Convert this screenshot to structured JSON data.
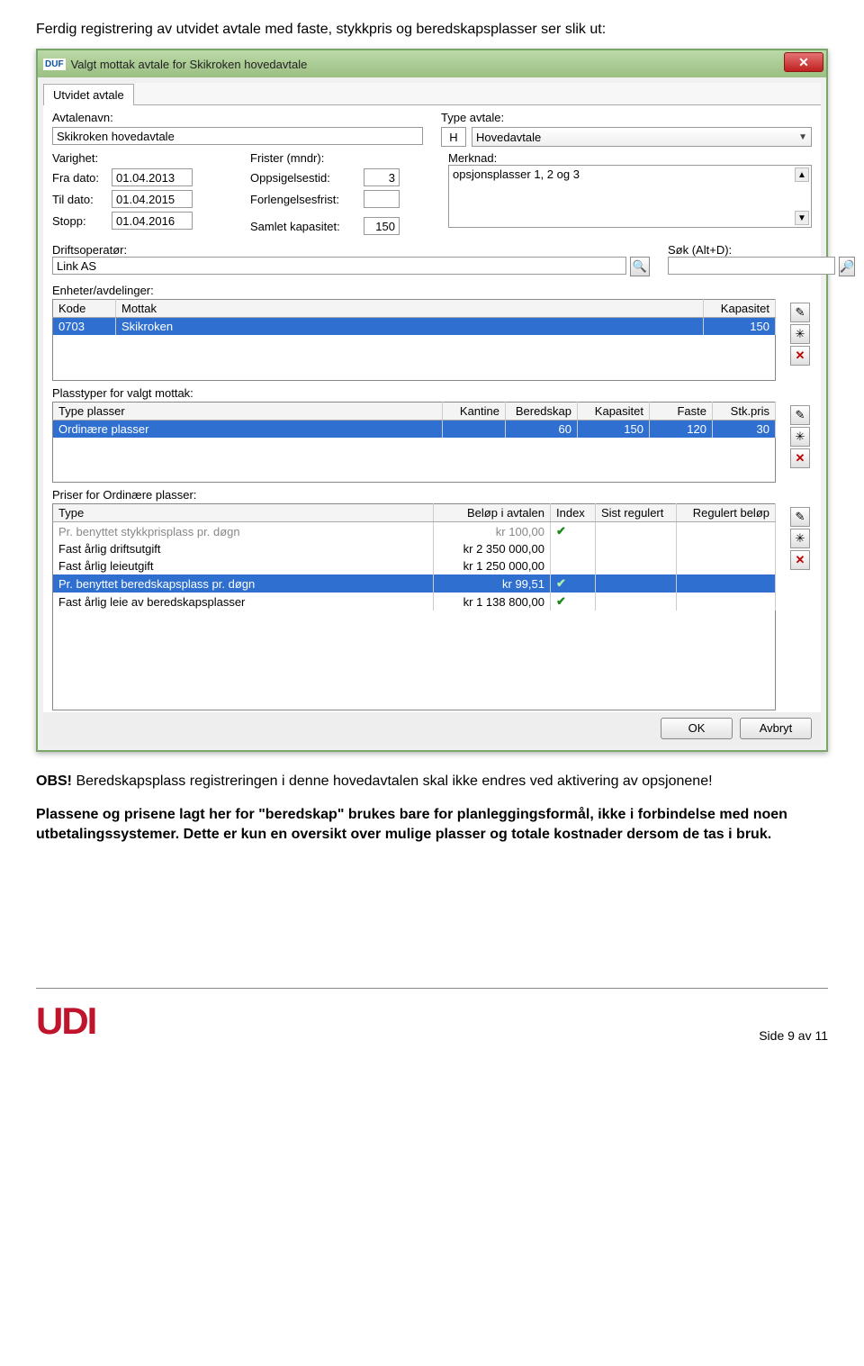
{
  "intro_text": "Ferdig registrering av utvidet avtale med faste, stykkpris og beredskapsplasser ser slik ut:",
  "window": {
    "app_icon_text": "DUF",
    "title": "Valgt mottak avtale for Skikroken hovedavtale",
    "close_symbol": "✕"
  },
  "tab_label": "Utvidet avtale",
  "labels": {
    "avtalenavn": "Avtalenavn:",
    "type_avtale": "Type avtale:",
    "varighet": "Varighet:",
    "fra_dato": "Fra dato:",
    "til_dato": "Til dato:",
    "stopp": "Stopp:",
    "frister": "Frister (mndr):",
    "oppsigelsestid": "Oppsigelsestid:",
    "forlengelsesfrist": "Forlengelsesfrist:",
    "samlet_kapasitet": "Samlet kapasitet:",
    "merknad": "Merknad:",
    "driftsoperator": "Driftsoperatør:",
    "sok": "Søk (Alt+D):",
    "enheter": "Enheter/avdelinger:",
    "plasstyper": "Plasstyper for valgt mottak:",
    "priser": "Priser for Ordinære plasser:"
  },
  "values": {
    "avtalenavn": "Skikroken hovedavtale",
    "type_avtale_code": "H",
    "type_avtale_text": "Hovedavtale",
    "fra_dato": "01.04.2013",
    "til_dato": "01.04.2015",
    "stopp": "01.04.2016",
    "oppsigelsestid": "3",
    "forlengelsesfrist": "",
    "samlet_kapasitet": "150",
    "merknad": "opsjonsplasser 1, 2 og 3",
    "driftsoperator": "Link AS",
    "sok": ""
  },
  "enheter_table": {
    "headers": {
      "kode": "Kode",
      "mottak": "Mottak",
      "kapasitet": "Kapasitet"
    },
    "rows": [
      {
        "kode": "0703",
        "mottak": "Skikroken",
        "kapasitet": "150",
        "selected": true
      }
    ]
  },
  "plasstyper_table": {
    "headers": {
      "type": "Type plasser",
      "kantine": "Kantine",
      "beredskap": "Beredskap",
      "kapasitet": "Kapasitet",
      "faste": "Faste",
      "stkpris": "Stk.pris"
    },
    "rows": [
      {
        "type": "Ordinære plasser",
        "kantine": "",
        "beredskap": "60",
        "kapasitet": "150",
        "faste": "120",
        "stkpris": "30",
        "selected": true
      }
    ]
  },
  "priser_table": {
    "headers": {
      "type": "Type",
      "belop": "Beløp i avtalen",
      "index": "Index",
      "sist": "Sist regulert",
      "regulert": "Regulert beløp"
    },
    "rows": [
      {
        "type": "Pr. benyttet stykkprisplass pr. døgn",
        "belop": "kr 100,00",
        "index": "✔",
        "sist": "",
        "regulert": "",
        "grey": true
      },
      {
        "type": "Fast årlig driftsutgift",
        "belop": "kr 2 350 000,00",
        "index": "",
        "sist": "",
        "regulert": ""
      },
      {
        "type": "Fast årlig leieutgift",
        "belop": "kr 1 250 000,00",
        "index": "",
        "sist": "",
        "regulert": ""
      },
      {
        "type": "Pr. benyttet beredskapsplass pr. døgn",
        "belop": "kr 99,51",
        "index": "✔",
        "sist": "",
        "regulert": "",
        "selected": true
      },
      {
        "type": "Fast årlig leie av beredskapsplasser",
        "belop": "kr 1 138 800,00",
        "index": "✔",
        "sist": "",
        "regulert": ""
      }
    ]
  },
  "buttons": {
    "ok": "OK",
    "avbryt": "Avbryt"
  },
  "side_icons": {
    "edit": "✎",
    "add": "✳",
    "del": "✕"
  },
  "icons": {
    "search": "🔍",
    "binoc": "🔎"
  },
  "after": {
    "line1a": "OBS!",
    "line1b": " Beredskapsplass registreringen i denne hovedavtalen skal ikke endres ved aktivering av opsjonene!",
    "line2": "Plassene og prisene lagt her for \"beredskap\" brukes bare for planleggingsformål, ikke i forbindelse med noen utbetalingssystemer. Dette er kun en oversikt over mulige plasser og totale kostnader dersom de tas i bruk."
  },
  "footer": {
    "logo": "UDI",
    "page": "Side 9 av 11"
  }
}
